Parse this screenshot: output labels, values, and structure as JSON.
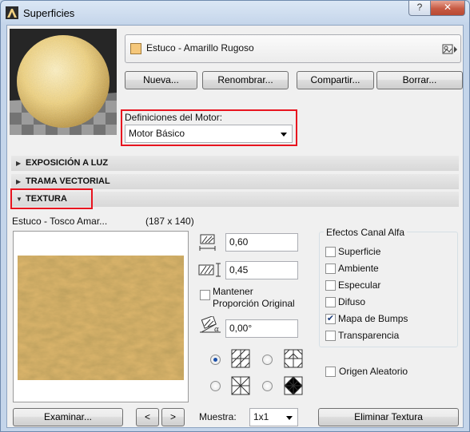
{
  "window": {
    "title": "Superficies",
    "help_label": "?",
    "close_label": "✕"
  },
  "material": {
    "name": "Estuco - Amarillo Rugoso",
    "swatch_color": "#f5c77a"
  },
  "buttons": {
    "new": "Nueva...",
    "rename": "Renombrar...",
    "share": "Compartir...",
    "delete": "Borrar..."
  },
  "engine": {
    "label": "Definiciones del Motor:",
    "value": "Motor Básico"
  },
  "sections": {
    "exposure": "EXPOSICIÓN A LUZ",
    "vector": "TRAMA VECTORIAL",
    "texture": "TEXTURA"
  },
  "texture": {
    "name": "Estuco - Tosco Amar...",
    "size": "(187 x 140)",
    "width": "0,60",
    "height": "0,45",
    "keep_ratio_label": "Mantener Proporción Original",
    "keep_ratio_checked": false,
    "angle": "0,00°",
    "browse_label": "Examinar...",
    "prev_label": "<",
    "next_label": ">",
    "sample_label": "Muestra:",
    "sample_value": "1x1",
    "remove_label": "Eliminar Textura",
    "random_origin_label": "Origen Aleatorio",
    "random_origin_checked": false
  },
  "alpha": {
    "title": "Efectos Canal Alfa",
    "items": [
      {
        "label": "Superficie",
        "checked": false
      },
      {
        "label": "Ambiente",
        "checked": false
      },
      {
        "label": "Especular",
        "checked": false
      },
      {
        "label": "Difuso",
        "checked": false
      },
      {
        "label": "Mapa de Bumps",
        "checked": true
      },
      {
        "label": "Transparencia",
        "checked": false
      }
    ]
  },
  "colors": {
    "highlight": "#e8141f",
    "texture_base": "#d9b36a"
  }
}
